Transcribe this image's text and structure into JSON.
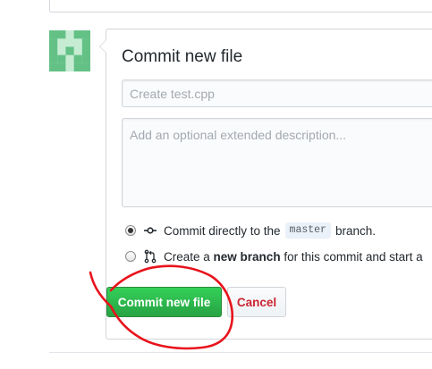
{
  "form": {
    "title": "Commit new file",
    "summary_placeholder": "Create test.cpp",
    "summary_value": "",
    "description_placeholder": "Add an optional extended description...",
    "description_value": ""
  },
  "options": {
    "direct": {
      "prefix": "Commit directly to the",
      "branch": "master",
      "suffix": "branch.",
      "selected": true
    },
    "new_branch": {
      "prefix": "Create a",
      "bold": "new branch",
      "suffix": "for this commit and start a",
      "selected": false
    }
  },
  "buttons": {
    "commit_label": "Commit new file",
    "cancel_label": "Cancel"
  },
  "icons": {
    "avatar": "identicon-avatar",
    "commit": "git-commit-icon",
    "pull_request": "git-pull-request-icon"
  },
  "colors": {
    "commit_button": "#28a745",
    "cancel_text": "#cb2431",
    "annotation": "#e8131c"
  }
}
